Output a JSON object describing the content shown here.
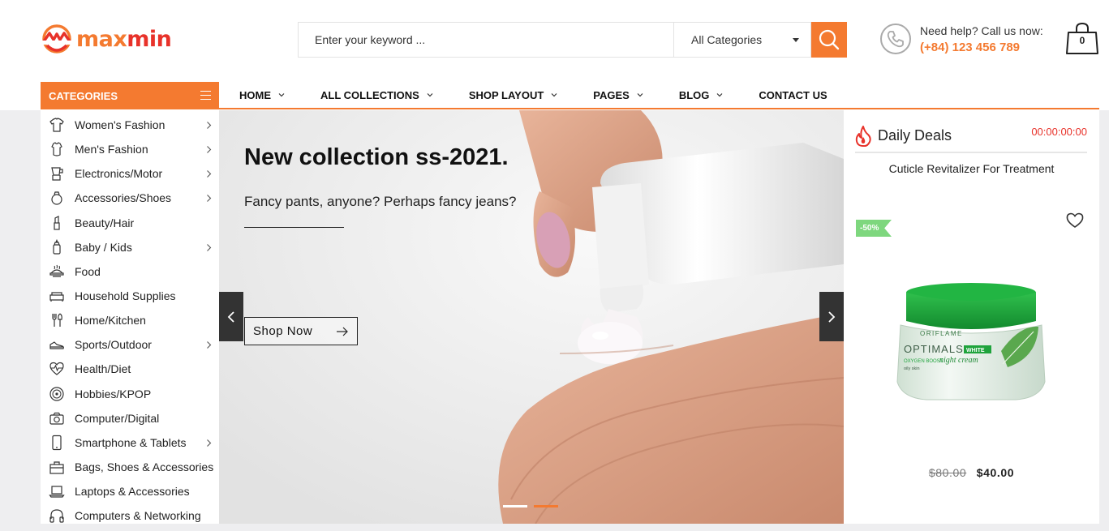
{
  "brand": {
    "logo_part1": "max",
    "logo_part2": "min"
  },
  "search": {
    "placeholder": "Enter your keyword ...",
    "category_selected": "All Categories"
  },
  "help": {
    "line1": "Need help? Call us now:",
    "phone": "(+84) 123 456 789"
  },
  "cart": {
    "count": "0"
  },
  "categories_heading": "CATEGORIES",
  "nav": {
    "items": [
      {
        "label": "HOME",
        "has_dropdown": true
      },
      {
        "label": "ALL COLLECTIONS",
        "has_dropdown": true
      },
      {
        "label": "SHOP LAYOUT",
        "has_dropdown": true
      },
      {
        "label": "PAGES",
        "has_dropdown": true
      },
      {
        "label": "BLOG",
        "has_dropdown": true
      },
      {
        "label": "CONTACT US",
        "has_dropdown": false
      }
    ]
  },
  "sidebar": {
    "items": [
      {
        "label": "Women's Fashion",
        "icon": "shirt-icon",
        "has_submenu": true
      },
      {
        "label": "Men's Fashion",
        "icon": "tshirt-icon",
        "has_submenu": true
      },
      {
        "label": "Electronics/Motor",
        "icon": "blender-icon",
        "has_submenu": true
      },
      {
        "label": "Accessories/Shoes",
        "icon": "ring-icon",
        "has_submenu": true
      },
      {
        "label": "Beauty/Hair",
        "icon": "lipstick-icon",
        "has_submenu": false
      },
      {
        "label": "Baby / Kids",
        "icon": "baby-bottle-icon",
        "has_submenu": true
      },
      {
        "label": "Food",
        "icon": "food-tray-icon",
        "has_submenu": false
      },
      {
        "label": "Household Supplies",
        "icon": "sofa-icon",
        "has_submenu": false
      },
      {
        "label": "Home/Kitchen",
        "icon": "cutlery-icon",
        "has_submenu": false
      },
      {
        "label": "Sports/Outdoor",
        "icon": "sneaker-icon",
        "has_submenu": true
      },
      {
        "label": "Health/Diet",
        "icon": "heart-pulse-icon",
        "has_submenu": false
      },
      {
        "label": "Hobbies/KPOP",
        "icon": "vinyl-icon",
        "has_submenu": false
      },
      {
        "label": "Computer/Digital",
        "icon": "camera-icon",
        "has_submenu": false
      },
      {
        "label": "Smartphone & Tablets",
        "icon": "smartphone-icon",
        "has_submenu": true
      },
      {
        "label": "Bags, Shoes & Accessories",
        "icon": "bag-icon",
        "has_submenu": false
      },
      {
        "label": "Laptops & Accessories",
        "icon": "laptop-icon",
        "has_submenu": false
      },
      {
        "label": "Computers & Networking",
        "icon": "headphones-icon",
        "has_submenu": false
      }
    ]
  },
  "hero": {
    "title": "New collection ss-2021.",
    "subtitle": "Fancy pants, anyone? Perhaps fancy jeans?",
    "button": "Shop Now",
    "active_slide": 2,
    "slide_count": 2
  },
  "deals": {
    "title": "Daily Deals",
    "timer": "00:00:00:00",
    "product_name": "Cuticle Revitalizer For Treatment",
    "discount_badge": "-50%",
    "price_old": "$80.00",
    "price_new": "$40.00",
    "jar_brand": "ORIFLAME",
    "jar_line": "OPTIMALS",
    "jar_tag": "WHITE",
    "jar_product": "night cream",
    "jar_sub": "OXYGEN BOOST",
    "jar_skin": "oily skin"
  },
  "colors": {
    "accent": "#f47a30",
    "accent_red": "#e8322a",
    "deal_badge": "#7ed77e"
  }
}
